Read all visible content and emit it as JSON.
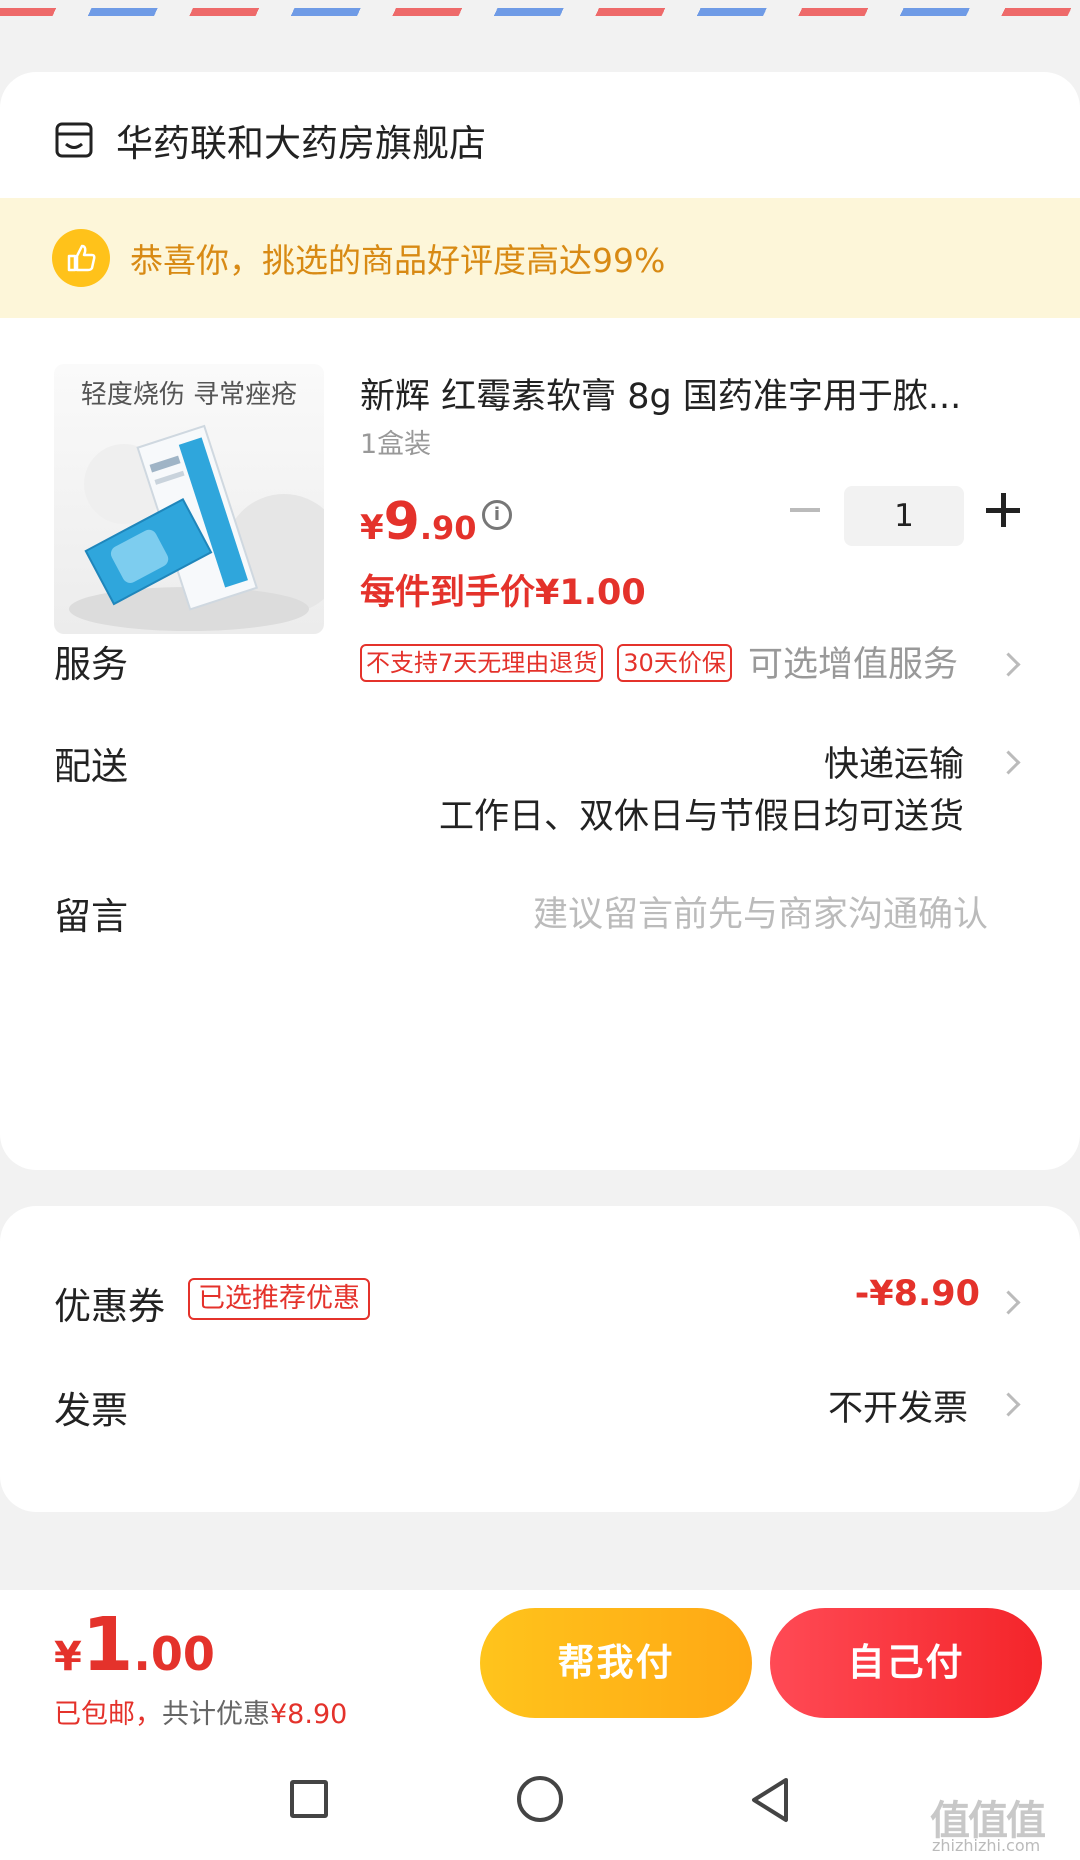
{
  "store": {
    "name": "华药联和大药房旗舰店"
  },
  "banner": {
    "text": "恭喜你，挑选的商品好评度高达99%"
  },
  "product": {
    "image_caption": "轻度烧伤 寻常痤疮",
    "title": "新辉 红霉素软膏 8g 国药准字用于脓...",
    "spec": "1盒装",
    "price_symbol": "¥",
    "price_integer": "9",
    "price_decimal": ".90",
    "quantity": "1",
    "final_price": "每件到手价¥1.00",
    "tags": [
      "不支持7天无理由退货",
      "30天价保"
    ]
  },
  "service": {
    "label": "服务",
    "value": "可选增值服务"
  },
  "delivery": {
    "label": "配送",
    "value": "快递运输",
    "detail": "工作日、双休日与节假日均可送货"
  },
  "message": {
    "label": "留言",
    "placeholder": "建议留言前先与商家沟通确认"
  },
  "coupon": {
    "label": "优惠券",
    "tag": "已选推荐优惠",
    "value": "-¥8.90"
  },
  "invoice": {
    "label": "发票",
    "value": "不开发票"
  },
  "footer": {
    "total_symbol": "¥",
    "total_integer": "1",
    "total_decimal": ".00",
    "shipping_prefix": "已包邮，",
    "shipping_saved_label": "共计优惠",
    "shipping_saved_value": "¥8.90",
    "help_pay_label": "帮我付",
    "self_pay_label": "自己付"
  },
  "watermark": {
    "text": "值值值",
    "url": "zhizhizhi.com"
  },
  "colors": {
    "accent_red": "#e4322b",
    "banner_bg": "#fdf6d9",
    "banner_text": "#d88a14",
    "help_btn": "#ffb516",
    "self_btn": "#f4252a"
  }
}
